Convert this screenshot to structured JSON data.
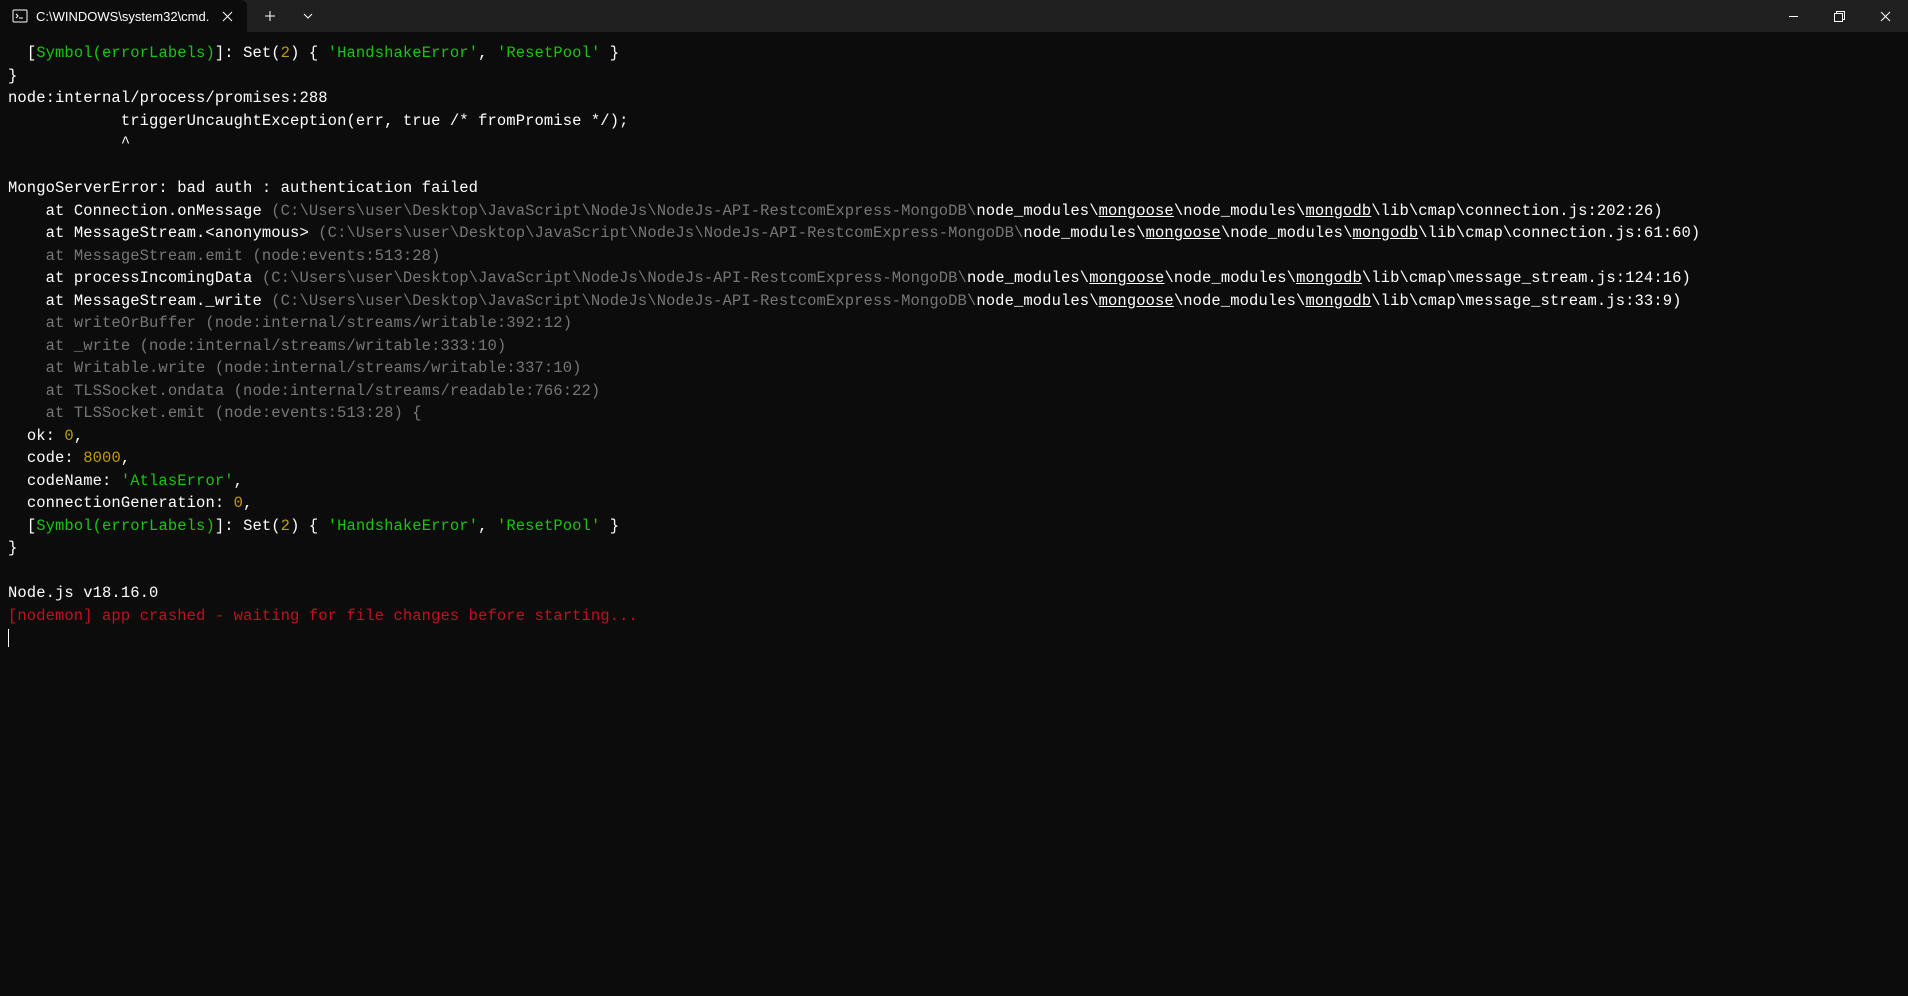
{
  "titlebar": {
    "tab_title": "C:\\WINDOWS\\system32\\cmd.",
    "plus": "+",
    "chevron": "⌄"
  },
  "term": {
    "l1a": "  [",
    "l1b": "Symbol(errorLabels)",
    "l1c": "]: Set(",
    "l1d": "2",
    "l1e": ") { ",
    "l1f": "'HandshakeError'",
    "l1g": ", ",
    "l1h": "'ResetPool'",
    "l1i": " }",
    "l2": "}",
    "l3": "node:internal/process/promises:288",
    "l4": "            triggerUncaughtException(err, true /* fromPromise */);",
    "l5": "            ^",
    "blank": "",
    "l6": "MongoServerError: bad auth : authentication failed",
    "l7a": "    at Connection.onMessage ",
    "l7b": "(C:\\Users\\user\\Desktop\\JavaScript\\NodeJs\\NodeJs-API-RestcomExpress-MongoDB\\",
    "l7c": "node_modules\\",
    "l7d": "mongoose",
    "l7e": "\\node_modules\\",
    "l7f": "mongodb",
    "l7g": "\\lib\\cmap\\connection.js:202:26)",
    "l8a": "    at MessageStream.<anonymous> ",
    "l8b": "(C:\\Users\\user\\Desktop\\JavaScript\\NodeJs\\NodeJs-API-RestcomExpress-MongoDB\\",
    "l8c": "node_modules\\",
    "l8d": "mongoose",
    "l8e": "\\node_modules\\",
    "l8f": "mongodb",
    "l8g": "\\lib\\cmap\\connection.js:61:60)",
    "l9": "    at MessageStream.emit (node:events:513:28)",
    "l10a": "    at processIncomingData ",
    "l10b": "(C:\\Users\\user\\Desktop\\JavaScript\\NodeJs\\NodeJs-API-RestcomExpress-MongoDB\\",
    "l10c": "node_modules\\",
    "l10d": "mongoose",
    "l10e": "\\node_modules\\",
    "l10f": "mongodb",
    "l10g": "\\lib\\cmap\\message_stream.js:124:16)",
    "l11a": "    at MessageStream._write ",
    "l11b": "(C:\\Users\\user\\Desktop\\JavaScript\\NodeJs\\NodeJs-API-RestcomExpress-MongoDB\\",
    "l11c": "node_modules\\",
    "l11d": "mongoose",
    "l11e": "\\node_modules\\",
    "l11f": "mongodb",
    "l11g": "\\lib\\cmap\\message_stream.js:33:9)",
    "l12": "    at writeOrBuffer (node:internal/streams/writable:392:12)",
    "l13": "    at _write (node:internal/streams/writable:333:10)",
    "l14": "    at Writable.write (node:internal/streams/writable:337:10)",
    "l15": "    at TLSSocket.ondata (node:internal/streams/readable:766:22)",
    "l16": "    at TLSSocket.emit (node:events:513:28) {",
    "l17a": "  ok: ",
    "l17b": "0",
    "l17c": ",",
    "l18a": "  code: ",
    "l18b": "8000",
    "l18c": ",",
    "l19a": "  codeName: ",
    "l19b": "'AtlasError'",
    "l19c": ",",
    "l20a": "  connectionGeneration: ",
    "l20b": "0",
    "l20c": ",",
    "l21a": "  [",
    "l21b": "Symbol(errorLabels)",
    "l21c": "]: Set(",
    "l21d": "2",
    "l21e": ") { ",
    "l21f": "'HandshakeError'",
    "l21g": ", ",
    "l21h": "'ResetPool'",
    "l21i": " }",
    "l22": "}",
    "l23": "Node.js v18.16.0",
    "l24": "[nodemon] app crashed - waiting for file changes before starting..."
  }
}
